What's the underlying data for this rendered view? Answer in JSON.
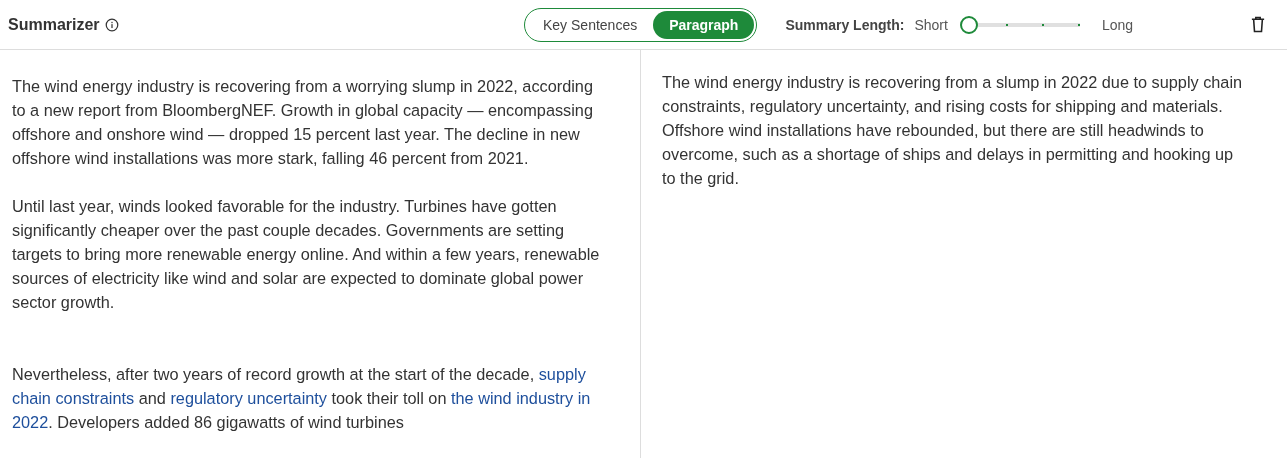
{
  "header": {
    "title": "Summarizer",
    "modes": [
      {
        "label": "Key Sentences",
        "selected": false
      },
      {
        "label": "Paragraph",
        "selected": true
      }
    ],
    "length_label": "Summary Length:",
    "length_min": "Short",
    "length_max": "Long",
    "length_slider": {
      "level": 0
    }
  },
  "source_paragraphs": [
    [
      {
        "text": "The wind energy industry is recovering from a worrying slump in 2022, according to a new report from BloombergNEF. Growth in global capacity — encompassing offshore and onshore wind — dropped 15 percent last year. The decline in new offshore wind installations was more stark, falling 46 percent from 2021.",
        "highlighted": false
      }
    ],
    [
      {
        "text": "Until last year, winds looked favorable for the industry. Turbines have gotten significantly cheaper over the past couple decades. Governments are setting targets to bring more renewable energy online. And within a few years, renewable sources of electricity like wind and solar are expected to dominate global power sector growth.",
        "highlighted": false
      }
    ],
    [
      {
        "text": "Nevertheless, after two years of record growth at the start of the decade, ",
        "highlighted": false
      },
      {
        "text": "supply chain constraints",
        "highlighted": true
      },
      {
        "text": " and ",
        "highlighted": false
      },
      {
        "text": "regulatory uncertainty",
        "highlighted": true
      },
      {
        "text": " took their toll on ",
        "highlighted": false
      },
      {
        "text": "the wind industry in 2022",
        "highlighted": true
      },
      {
        "text": ". Developers added 86 gigawatts of wind turbines",
        "highlighted": false
      }
    ]
  ],
  "summary": "The wind energy industry is recovering from a slump in 2022 due to supply chain constraints, regulatory uncertainty, and rising costs for shipping and materials. Offshore wind installations have rebounded, but there are still headwinds to overcome, such as a shortage of ships and delays in permitting and hooking up to the grid."
}
